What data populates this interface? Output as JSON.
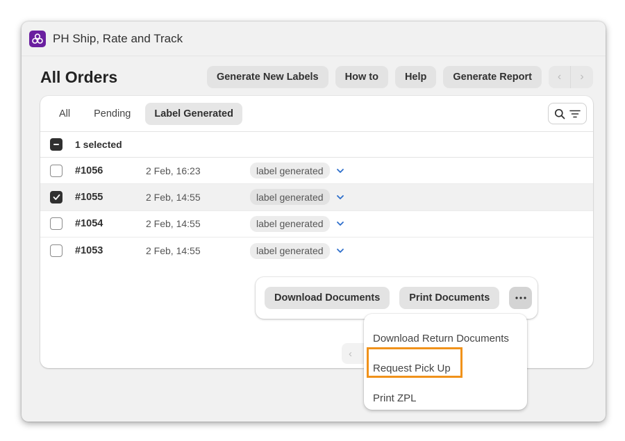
{
  "window": {
    "app_title": "PH Ship, Rate and Track",
    "app_icon": "app-logo-icon",
    "brand_color": "#6a1f9f"
  },
  "header": {
    "page_title": "All Orders",
    "actions": [
      {
        "label": "Generate New Labels"
      },
      {
        "label": "How to"
      },
      {
        "label": "Help"
      },
      {
        "label": "Generate Report"
      }
    ],
    "pager": {
      "prev_icon": "chevron-left-icon",
      "next_icon": "chevron-right-icon"
    }
  },
  "tabs": [
    {
      "label": "All",
      "active": false
    },
    {
      "label": "Pending",
      "active": false
    },
    {
      "label": "Label Generated",
      "active": true
    }
  ],
  "toolbar": {
    "search_icon": "search-icon",
    "filter_icon": "filter-icon"
  },
  "bulk": {
    "label": "1 selected",
    "state": "indeterminate"
  },
  "orders": [
    {
      "id": "#1056",
      "date": "2 Feb, 16:23",
      "status": "label generated",
      "selected": false
    },
    {
      "id": "#1055",
      "date": "2 Feb, 14:55",
      "status": "label generated",
      "selected": true
    },
    {
      "id": "#1054",
      "date": "2 Feb, 14:55",
      "status": "label generated",
      "selected": false
    },
    {
      "id": "#1053",
      "date": "2 Feb, 14:55",
      "status": "label generated",
      "selected": false
    }
  ],
  "bulk_actions": {
    "download_label": "Download Documents",
    "print_label": "Print Documents",
    "more_icon": "more-horizontal-icon"
  },
  "more_menu": {
    "items": [
      {
        "label": "Download Return Documents",
        "highlighted": false
      },
      {
        "label": "Request Pick Up",
        "highlighted": true
      },
      {
        "label": "Print ZPL",
        "highlighted": false
      }
    ],
    "highlight_color": "#f0921a"
  },
  "colors": {
    "chevron_accent": "#2c6ecb",
    "selected_row": "#f1f1f1"
  }
}
